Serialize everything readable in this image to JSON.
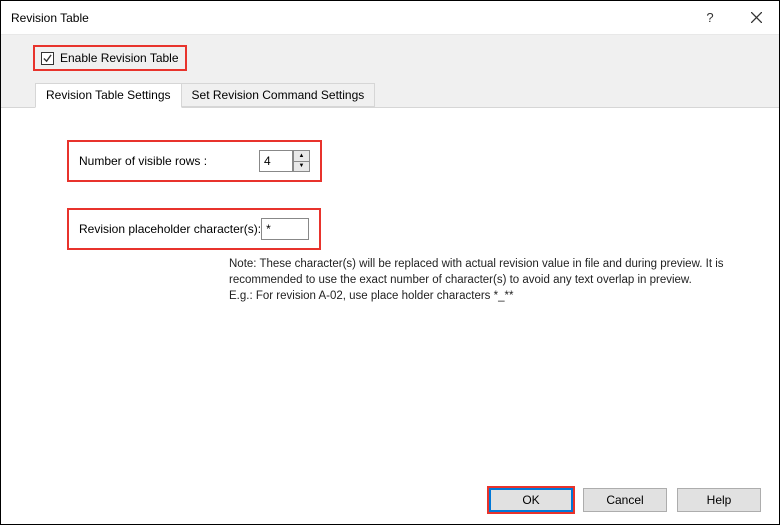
{
  "titlebar": {
    "title": "Revision Table"
  },
  "checkbox": {
    "label": "Enable Revision Table",
    "checked": true
  },
  "tabs": {
    "active": "Revision Table Settings",
    "inactive": "Set Revision Command Settings"
  },
  "fields": {
    "rows_label": "Number of visible rows :",
    "rows_value": "4",
    "placeholder_label": "Revision placeholder character(s):",
    "placeholder_value": "*"
  },
  "note": {
    "line1": "Note: These character(s) will be replaced with actual revision value in file and during preview. It is recommended to use the exact number of character(s) to avoid any text overlap in preview.",
    "line2": "E.g.: For revision A-02, use place holder characters *_**"
  },
  "buttons": {
    "ok": "OK",
    "cancel": "Cancel",
    "help": "Help"
  }
}
